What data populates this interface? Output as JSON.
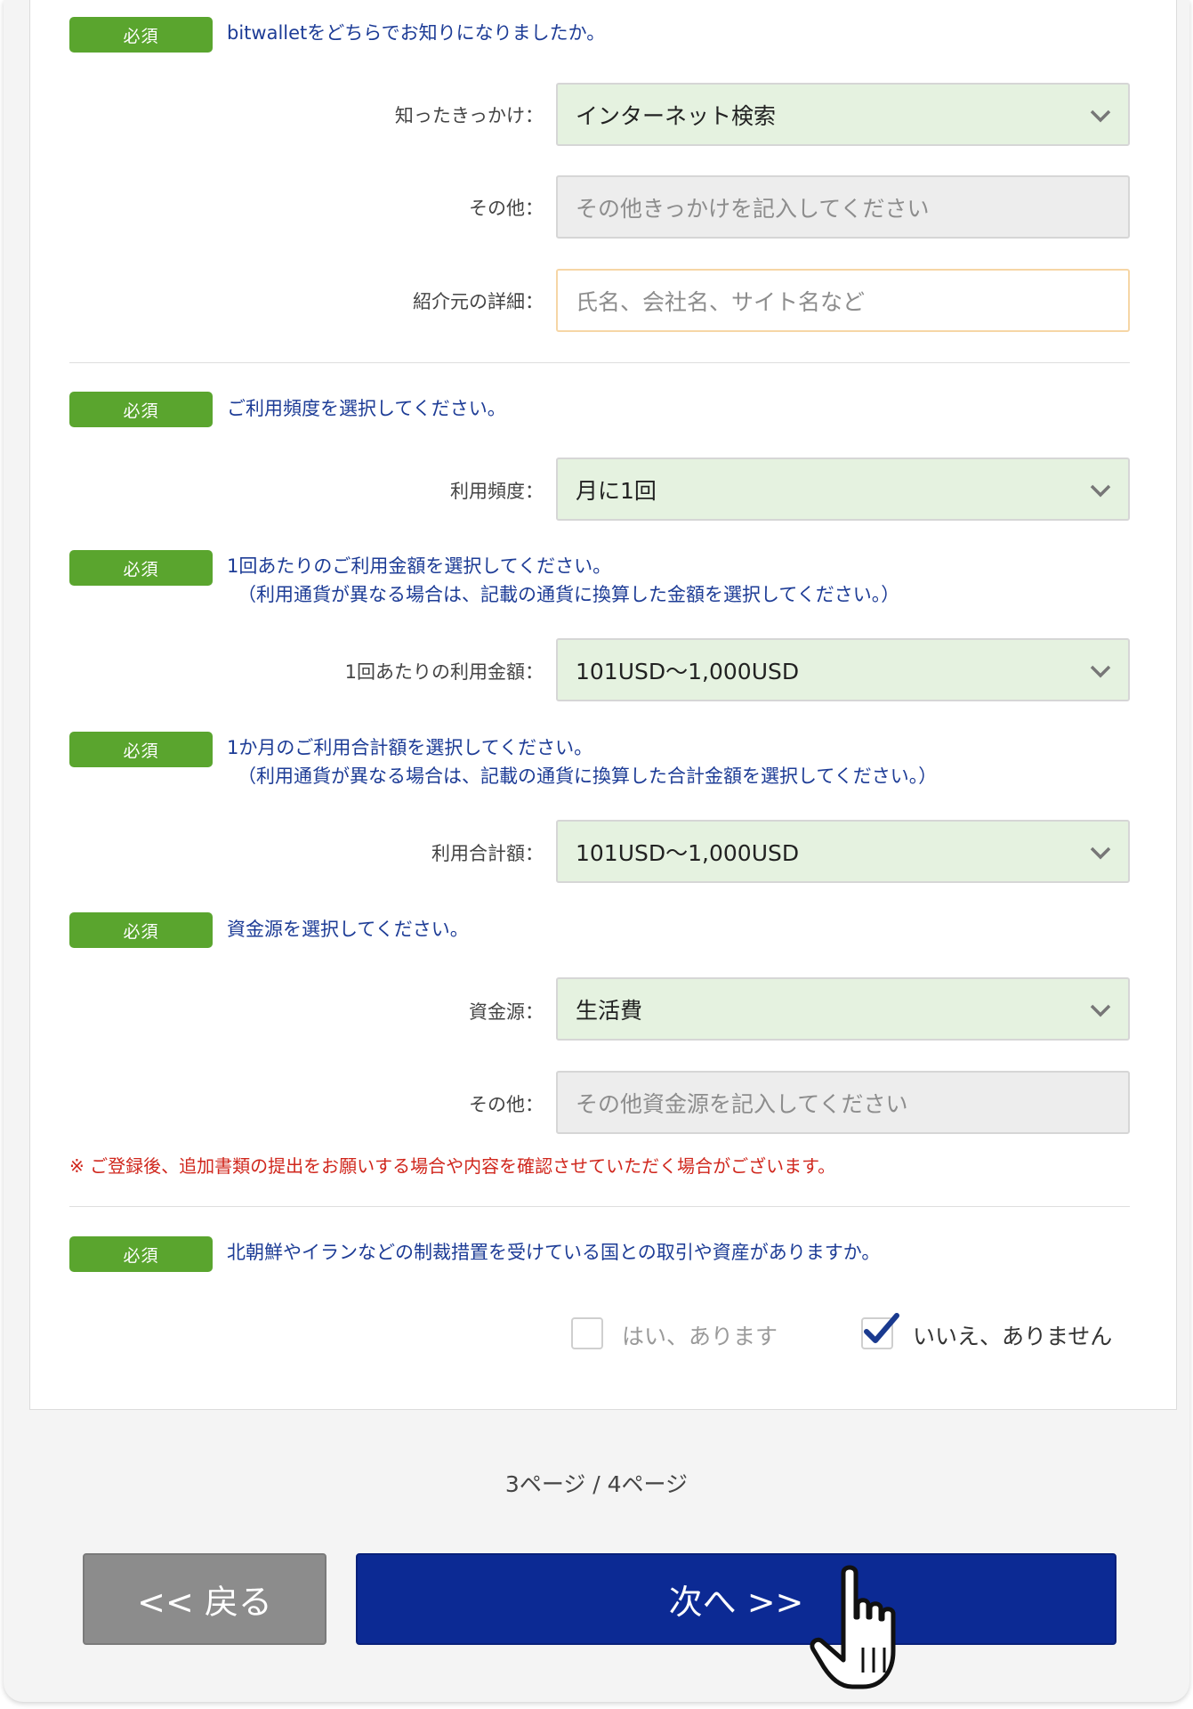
{
  "required_badge": "必須",
  "section_referral": {
    "question": "bitwalletをどちらでお知りになりましたか。",
    "source_label": "知ったきっかけ：",
    "source_value": "インターネット検索",
    "other_label": "その他：",
    "other_placeholder": "その他きっかけを記入してください",
    "detail_label": "紹介元の詳細：",
    "detail_placeholder": "氏名、会社名、サイト名など"
  },
  "section_frequency": {
    "question": "ご利用頻度を選択してください。",
    "label": "利用頻度：",
    "value": "月に1回"
  },
  "section_amount": {
    "question": "1回あたりのご利用金額を選択してください。",
    "note": "（利用通貨が異なる場合は、記載の通貨に換算した金額を選択してください。）",
    "label": "1回あたりの利用金額：",
    "value": "101USD〜1,000USD"
  },
  "section_monthly": {
    "question": "1か月のご利用合計額を選択してください。",
    "note": "（利用通貨が異なる場合は、記載の通貨に換算した合計金額を選択してください。）",
    "label": "利用合計額：",
    "value": "101USD〜1,000USD"
  },
  "section_funds": {
    "question": "資金源を選択してください。",
    "label": "資金源：",
    "value": "生活費",
    "other_label": "その他：",
    "other_placeholder": "その他資金源を記入してください",
    "notice": "※ ご登録後、追加書類の提出をお願いする場合や内容を確認させていただく場合がございます。"
  },
  "section_sanctions": {
    "question": "北朝鮮やイランなどの制裁措置を受けている国との取引や資産がありますか。",
    "option_yes": "はい、あります",
    "option_no": "いいえ、ありません",
    "selected": "no"
  },
  "pager": "3ページ / 4ページ",
  "buttons": {
    "back": "<< 戻る",
    "next": "次へ >>"
  },
  "colors": {
    "badge": "#5aa52e",
    "question_text": "#1d3c96",
    "select_bg": "#e5f2e0",
    "notice_text": "#d0271d",
    "next_button": "#0c2a94",
    "back_button": "#8c8c8c"
  }
}
